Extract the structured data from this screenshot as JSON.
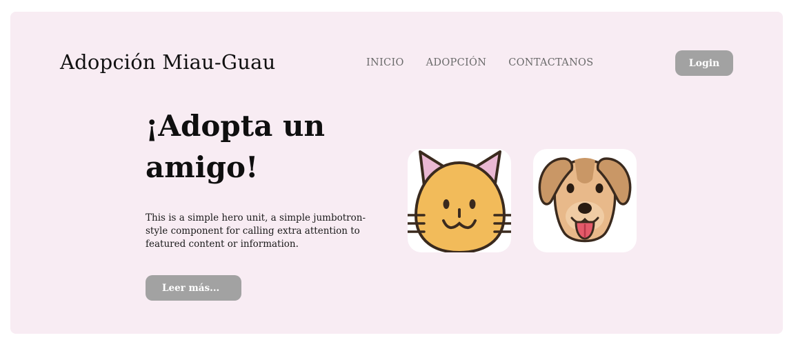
{
  "navbar": {
    "brand": "Adopción Miau-Guau",
    "links": [
      "INICIO",
      "ADOPCIÓN",
      "CONTACTANOS"
    ],
    "login_label": "Login"
  },
  "hero": {
    "title": "¡Adopta un amigo!",
    "text": "This is a simple hero unit, a simple jumbotron-style component for calling extra attention to featured content or information.",
    "button_label": "Leer más..."
  },
  "images": {
    "cat": "cat-face-icon",
    "dog": "dog-face-icon"
  },
  "colors": {
    "background": "#f8ecf3",
    "button": "#a2a2a2",
    "cat_fur": "#f2bb5a",
    "cat_ear_inner": "#eab8d3",
    "dog_fur": "#e8b98a",
    "dog_ears": "#c99766",
    "dog_tongue": "#e45a6a"
  }
}
